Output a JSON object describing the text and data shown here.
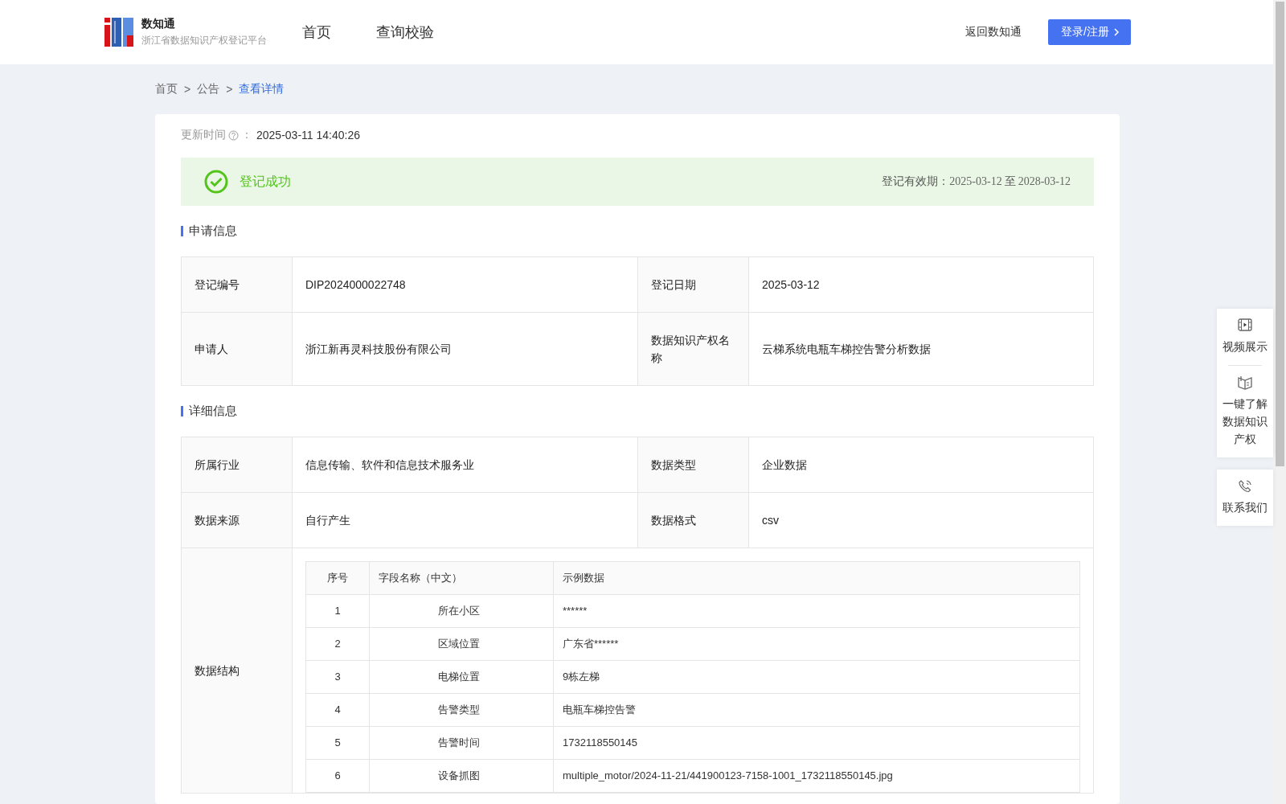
{
  "header": {
    "logo": {
      "title": "数知通",
      "subtitle": "浙江省数据知识产权登记平台"
    },
    "nav": [
      {
        "label": "首页"
      },
      {
        "label": "查询校验"
      }
    ],
    "back_link": "返回数知通",
    "login_button": "登录/注册"
  },
  "breadcrumb": [
    {
      "label": "首页",
      "selected": false
    },
    {
      "label": "公告",
      "selected": false
    },
    {
      "label": "查看详情",
      "selected": true
    }
  ],
  "breadcrumb_separator": ">",
  "update": {
    "label": "更新时间",
    "colon": "：",
    "value": "2025-03-11 14:40:26"
  },
  "status": {
    "text": "登记成功",
    "validity_label": "登记有效期：",
    "start": "2025-03-12",
    "separator": "至",
    "end": "2028-03-12"
  },
  "sections": [
    {
      "title": "申请信息",
      "rows": [
        {
          "kind": "pair",
          "cells": [
            {
              "label": "登记编号",
              "value": "DIP2024000022748"
            },
            {
              "label": "登记日期",
              "value": "2025-03-12"
            }
          ]
        },
        {
          "kind": "pair",
          "cells": [
            {
              "label": "申请人",
              "value": "浙江新再灵科技股份有限公司"
            },
            {
              "label": "数据知识产权名称",
              "value": "云梯系统电瓶车梯控告警分析数据"
            }
          ]
        }
      ]
    },
    {
      "title": "详细信息",
      "rows": [
        {
          "kind": "pair",
          "cells": [
            {
              "label": "所属行业",
              "value": "信息传输、软件和信息技术服务业"
            },
            {
              "label": "数据类型",
              "value": "企业数据"
            }
          ]
        },
        {
          "kind": "pair",
          "cells": [
            {
              "label": "数据来源",
              "value": "自行产生"
            },
            {
              "label": "数据格式",
              "value": "csv"
            }
          ]
        },
        {
          "kind": "structure",
          "label": "数据结构",
          "table": {
            "columns": [
              "序号",
              "字段名称（中文）",
              "示例数据"
            ],
            "rows": [
              [
                "1",
                "所在小区",
                "******"
              ],
              [
                "2",
                "区域位置",
                "广东省******"
              ],
              [
                "3",
                "电梯位置",
                "9栋左梯"
              ],
              [
                "4",
                "告警类型",
                "电瓶车梯控告警"
              ],
              [
                "5",
                "告警时间",
                "1732118550145"
              ],
              [
                "6",
                "设备抓图",
                "multiple_motor/2024-11-21/441900123-7158-1001_1732118550145.jpg"
              ]
            ]
          }
        }
      ]
    }
  ],
  "float_panel": [
    {
      "kind": "video",
      "label": "视频展示"
    },
    {
      "kind": "book",
      "label": "一键了解数据知识产权"
    }
  ],
  "contact": {
    "kind": "phone",
    "label": "联系我们"
  }
}
